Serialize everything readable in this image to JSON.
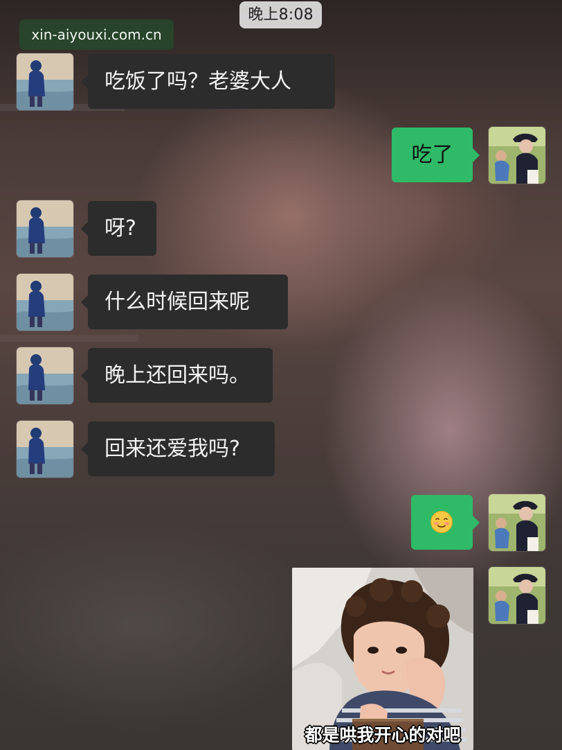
{
  "chat": {
    "timestamp": "晚上8:08",
    "watermark": "xin-aiyouxi.com.cn",
    "messages": [
      {
        "text": "吃饭了吗？老婆大人"
      },
      {
        "text": "吃了"
      },
      {
        "text": "呀?"
      },
      {
        "text": "什么时候回来呢"
      },
      {
        "text": "晚上还回来吗。"
      },
      {
        "text": "回来还爱我吗?"
      },
      {
        "emoji": "shy-smiling-face"
      },
      {
        "sticker_caption": "都是哄我开心的对吧"
      }
    ]
  },
  "colors": {
    "outgoing_bubble": "#2fba68",
    "incoming_bubble": "#2c2c2c",
    "incoming_text": "#f4f4f4",
    "outgoing_text": "#101010"
  },
  "icons": {
    "contact_avatar": "hooded-person-at-seaside-avatar",
    "user_avatar": "mother-and-child-avatar",
    "emoji": "shy-smiling-face-emoji"
  }
}
